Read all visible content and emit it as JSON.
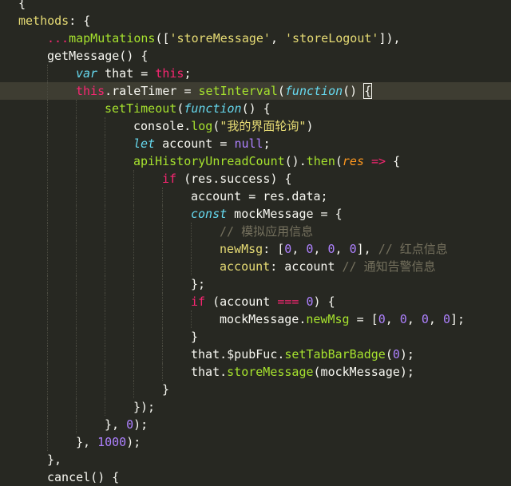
{
  "editor": {
    "theme": "monokai",
    "colors": {
      "background": "#272822",
      "active_line": "#3e3d32",
      "plain": "#f8f8f2",
      "keyword": "#f92672",
      "function": "#a6e22e",
      "string": "#e6db74",
      "number": "#ae81ff",
      "storage": "#66d9ef",
      "parameter": "#fd971f",
      "comment": "#75715e"
    },
    "lines": [
      {
        "indent": 0,
        "tokens": [
          {
            "t": "plain",
            "v": "{"
          }
        ]
      },
      {
        "indent": 0,
        "tokens": [
          {
            "t": "prop",
            "v": "methods"
          },
          {
            "t": "plain",
            "v": ": {"
          }
        ]
      },
      {
        "indent": 1,
        "tokens": [
          {
            "t": "kw",
            "v": "..."
          },
          {
            "t": "fn",
            "v": "mapMutations"
          },
          {
            "t": "plain",
            "v": "(["
          },
          {
            "t": "str",
            "v": "'storeMessage'"
          },
          {
            "t": "plain",
            "v": ", "
          },
          {
            "t": "str",
            "v": "'storeLogout'"
          },
          {
            "t": "plain",
            "v": "]),"
          }
        ]
      },
      {
        "indent": 1,
        "tokens": [
          {
            "t": "plain",
            "v": "getMessage() {"
          }
        ]
      },
      {
        "indent": 2,
        "tokens": [
          {
            "t": "storage",
            "v": "var"
          },
          {
            "t": "plain",
            "v": " that = "
          },
          {
            "t": "kw",
            "v": "this"
          },
          {
            "t": "plain",
            "v": ";"
          }
        ]
      },
      {
        "indent": 2,
        "active": true,
        "tokens": [
          {
            "t": "kw",
            "v": "this"
          },
          {
            "t": "plain",
            "v": ".raleTimer = "
          },
          {
            "t": "fn",
            "v": "setInterval"
          },
          {
            "t": "plain",
            "v": "("
          },
          {
            "t": "storage",
            "v": "function"
          },
          {
            "t": "plain",
            "v": "() "
          },
          {
            "t": "bracket",
            "v": "{"
          }
        ]
      },
      {
        "indent": 3,
        "tokens": [
          {
            "t": "fn",
            "v": "setTimeout"
          },
          {
            "t": "plain",
            "v": "("
          },
          {
            "t": "storage",
            "v": "function"
          },
          {
            "t": "plain",
            "v": "() {"
          }
        ]
      },
      {
        "indent": 4,
        "tokens": [
          {
            "t": "plain",
            "v": "console."
          },
          {
            "t": "fn",
            "v": "log"
          },
          {
            "t": "plain",
            "v": "("
          },
          {
            "t": "str",
            "v": "\"我的界面轮询\""
          },
          {
            "t": "plain",
            "v": ")"
          }
        ]
      },
      {
        "indent": 4,
        "tokens": [
          {
            "t": "storage",
            "v": "let"
          },
          {
            "t": "plain",
            "v": " account = "
          },
          {
            "t": "num",
            "v": "null"
          },
          {
            "t": "plain",
            "v": ";"
          }
        ]
      },
      {
        "indent": 4,
        "tokens": [
          {
            "t": "fn",
            "v": "apiHistoryUnreadCount"
          },
          {
            "t": "plain",
            "v": "()."
          },
          {
            "t": "fn",
            "v": "then"
          },
          {
            "t": "plain",
            "v": "("
          },
          {
            "t": "param",
            "v": "res"
          },
          {
            "t": "plain",
            "v": " "
          },
          {
            "t": "kw",
            "v": "=>"
          },
          {
            "t": "plain",
            "v": " {"
          }
        ]
      },
      {
        "indent": 5,
        "tokens": [
          {
            "t": "kw",
            "v": "if"
          },
          {
            "t": "plain",
            "v": " (res.success) {"
          }
        ]
      },
      {
        "indent": 6,
        "tokens": [
          {
            "t": "plain",
            "v": "account = res.data;"
          }
        ]
      },
      {
        "indent": 6,
        "tokens": [
          {
            "t": "storage",
            "v": "const"
          },
          {
            "t": "plain",
            "v": " mockMessage = {"
          }
        ]
      },
      {
        "indent": 7,
        "tokens": [
          {
            "t": "comment",
            "v": "// 模拟应用信息"
          }
        ]
      },
      {
        "indent": 7,
        "tokens": [
          {
            "t": "prop",
            "v": "newMsg"
          },
          {
            "t": "plain",
            "v": ": ["
          },
          {
            "t": "num",
            "v": "0"
          },
          {
            "t": "plain",
            "v": ", "
          },
          {
            "t": "num",
            "v": "0"
          },
          {
            "t": "plain",
            "v": ", "
          },
          {
            "t": "num",
            "v": "0"
          },
          {
            "t": "plain",
            "v": ", "
          },
          {
            "t": "num",
            "v": "0"
          },
          {
            "t": "plain",
            "v": "], "
          },
          {
            "t": "comment",
            "v": "// 红点信息"
          }
        ]
      },
      {
        "indent": 7,
        "tokens": [
          {
            "t": "prop",
            "v": "account"
          },
          {
            "t": "plain",
            "v": ": account "
          },
          {
            "t": "comment",
            "v": "// 通知告警信息"
          }
        ]
      },
      {
        "indent": 6,
        "tokens": [
          {
            "t": "plain",
            "v": "};"
          }
        ]
      },
      {
        "indent": 6,
        "tokens": [
          {
            "t": "kw",
            "v": "if"
          },
          {
            "t": "plain",
            "v": " (account "
          },
          {
            "t": "kw",
            "v": "==="
          },
          {
            "t": "plain",
            "v": " "
          },
          {
            "t": "num",
            "v": "0"
          },
          {
            "t": "plain",
            "v": ") {"
          }
        ]
      },
      {
        "indent": 7,
        "tokens": [
          {
            "t": "plain",
            "v": "mockMessage."
          },
          {
            "t": "fn",
            "v": "newMsg"
          },
          {
            "t": "plain",
            "v": " = ["
          },
          {
            "t": "num",
            "v": "0"
          },
          {
            "t": "plain",
            "v": ", "
          },
          {
            "t": "num",
            "v": "0"
          },
          {
            "t": "plain",
            "v": ", "
          },
          {
            "t": "num",
            "v": "0"
          },
          {
            "t": "plain",
            "v": ", "
          },
          {
            "t": "num",
            "v": "0"
          },
          {
            "t": "plain",
            "v": "];"
          }
        ]
      },
      {
        "indent": 6,
        "tokens": [
          {
            "t": "plain",
            "v": "}"
          }
        ]
      },
      {
        "indent": 6,
        "tokens": [
          {
            "t": "plain",
            "v": "that.$pubFuc."
          },
          {
            "t": "fn",
            "v": "setTabBarBadge"
          },
          {
            "t": "plain",
            "v": "("
          },
          {
            "t": "num",
            "v": "0"
          },
          {
            "t": "plain",
            "v": ");"
          }
        ]
      },
      {
        "indent": 6,
        "tokens": [
          {
            "t": "plain",
            "v": "that."
          },
          {
            "t": "fn",
            "v": "storeMessage"
          },
          {
            "t": "plain",
            "v": "(mockMessage);"
          }
        ]
      },
      {
        "indent": 5,
        "tokens": [
          {
            "t": "plain",
            "v": "}"
          }
        ]
      },
      {
        "indent": 4,
        "tokens": [
          {
            "t": "plain",
            "v": "});"
          }
        ]
      },
      {
        "indent": 3,
        "tokens": [
          {
            "t": "plain",
            "v": "}, "
          },
          {
            "t": "num",
            "v": "0"
          },
          {
            "t": "plain",
            "v": ");"
          }
        ]
      },
      {
        "indent": 2,
        "tokens": [
          {
            "t": "plain",
            "v": "}, "
          },
          {
            "t": "num",
            "v": "1000"
          },
          {
            "t": "plain",
            "v": ");"
          }
        ]
      },
      {
        "indent": 1,
        "tokens": [
          {
            "t": "plain",
            "v": "},"
          }
        ]
      },
      {
        "indent": 1,
        "tokens": [
          {
            "t": "plain",
            "v": "cancel() {"
          }
        ]
      }
    ]
  }
}
